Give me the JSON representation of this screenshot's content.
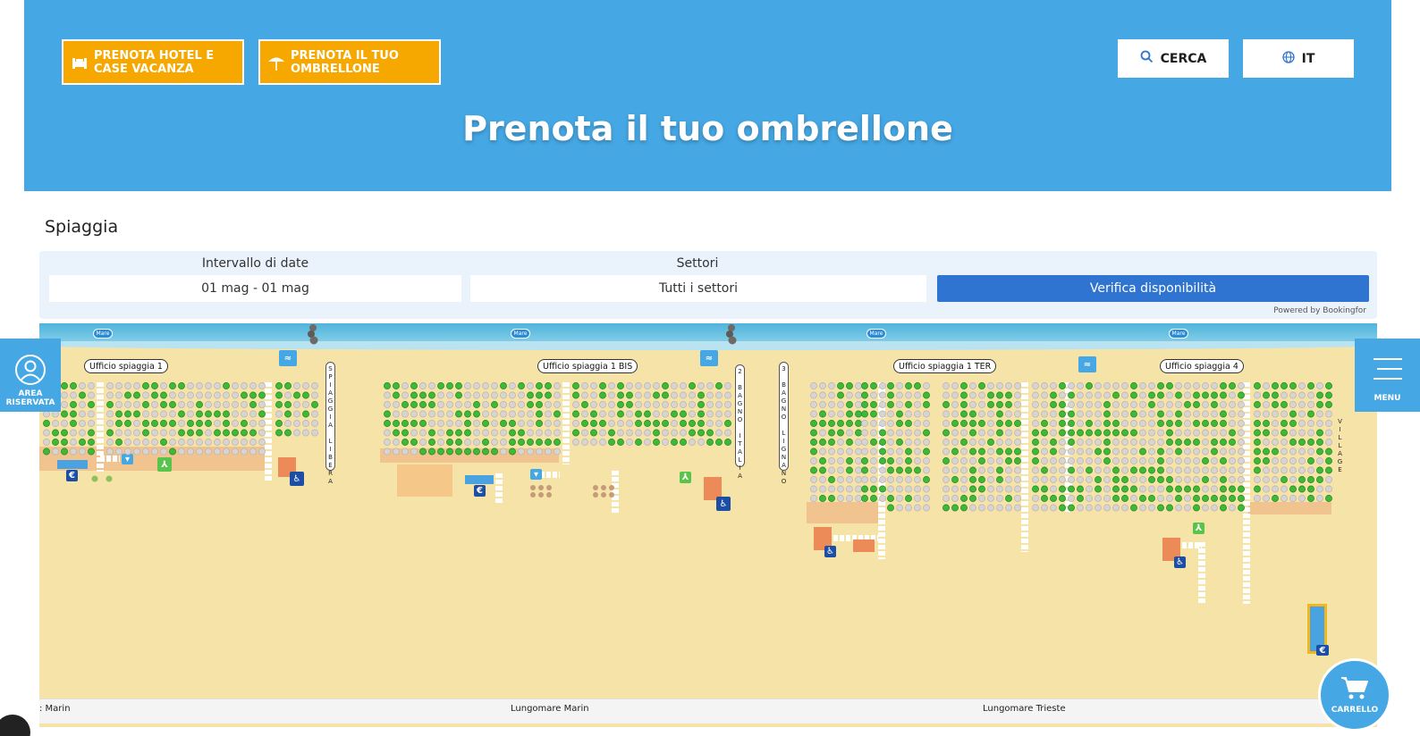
{
  "header": {
    "cta_hotel": "PRENOTA HOTEL E CASE VACANZA",
    "cta_hotel_line1": "PRENOTA HOTEL E",
    "cta_hotel_line2": "CASE VACANZA",
    "cta_umbrella_line1": "PRENOTA IL TUO",
    "cta_umbrella_line2": "OMBRELLONE",
    "search_label": "CERCA",
    "lang_label": "IT",
    "title": "Prenota il tuo ombrellone"
  },
  "section": {
    "title": "Spiaggia"
  },
  "filter": {
    "dates_label": "Intervallo di date",
    "dates_value": "01 mag - 01 mag",
    "sectors_label": "Settori",
    "sectors_value": "Tutti i settori",
    "submit_label": "Verifica disponibilità",
    "powered_by": "Powered by Bookingfor"
  },
  "map": {
    "sea_tag": "Mare",
    "offices": [
      "Ufficio spiaggia 1",
      "Ufficio spiaggia 1 BIS",
      "Ufficio spiaggia 1 TER",
      "Ufficio spiaggia 4"
    ],
    "vertical_labels": [
      "SPIAGGIA LIBERA",
      "2 BAGNO ITALIA",
      "3 BAGNO LIGNANO",
      "VILLAGE"
    ],
    "roads": [
      ": Marin",
      "Lungomare Marin",
      "Lungomare Trieste"
    ],
    "colors": {
      "available": "#3fb83a",
      "occupied": "#d8d4d4",
      "sand": "#f6e3a8",
      "sea": "#4fb4dc"
    }
  },
  "side": {
    "area_line1": "AREA",
    "area_line2": "RISERVATA",
    "menu_label": "MENU",
    "cart_label": "CARRELLO"
  },
  "icons": [
    "bed-icon",
    "umbrella-icon",
    "search-icon",
    "globe-icon",
    "user-icon",
    "menu-icon",
    "cart-icon"
  ]
}
